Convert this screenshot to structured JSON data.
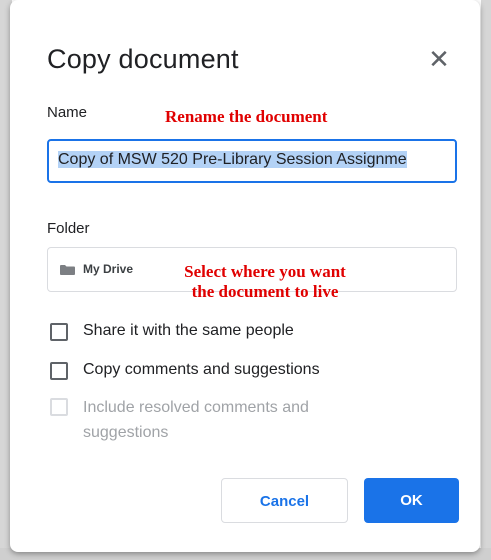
{
  "dialog": {
    "title": "Copy document",
    "close_icon": "close-icon"
  },
  "name_section": {
    "label": "Name",
    "value": "Copy of MSW 520 Pre-Library Session Assignme",
    "annotation": "Rename the document"
  },
  "folder_section": {
    "label": "Folder",
    "folder_icon": "folder-icon",
    "folder_name": "My Drive",
    "annotation_line1": "Select where you want",
    "annotation_line2": "the document to live"
  },
  "options": [
    {
      "label": "Share it with the same people",
      "checked": false,
      "disabled": false
    },
    {
      "label": "Copy comments and suggestions",
      "checked": false,
      "disabled": false
    },
    {
      "label": "Include resolved comments and suggestions",
      "checked": false,
      "disabled": true
    }
  ],
  "buttons": {
    "cancel_label": "Cancel",
    "ok_label": "OK"
  },
  "colors": {
    "accent": "#1a73e8",
    "annotation": "#e00000",
    "selection": "#b3d2f6"
  }
}
